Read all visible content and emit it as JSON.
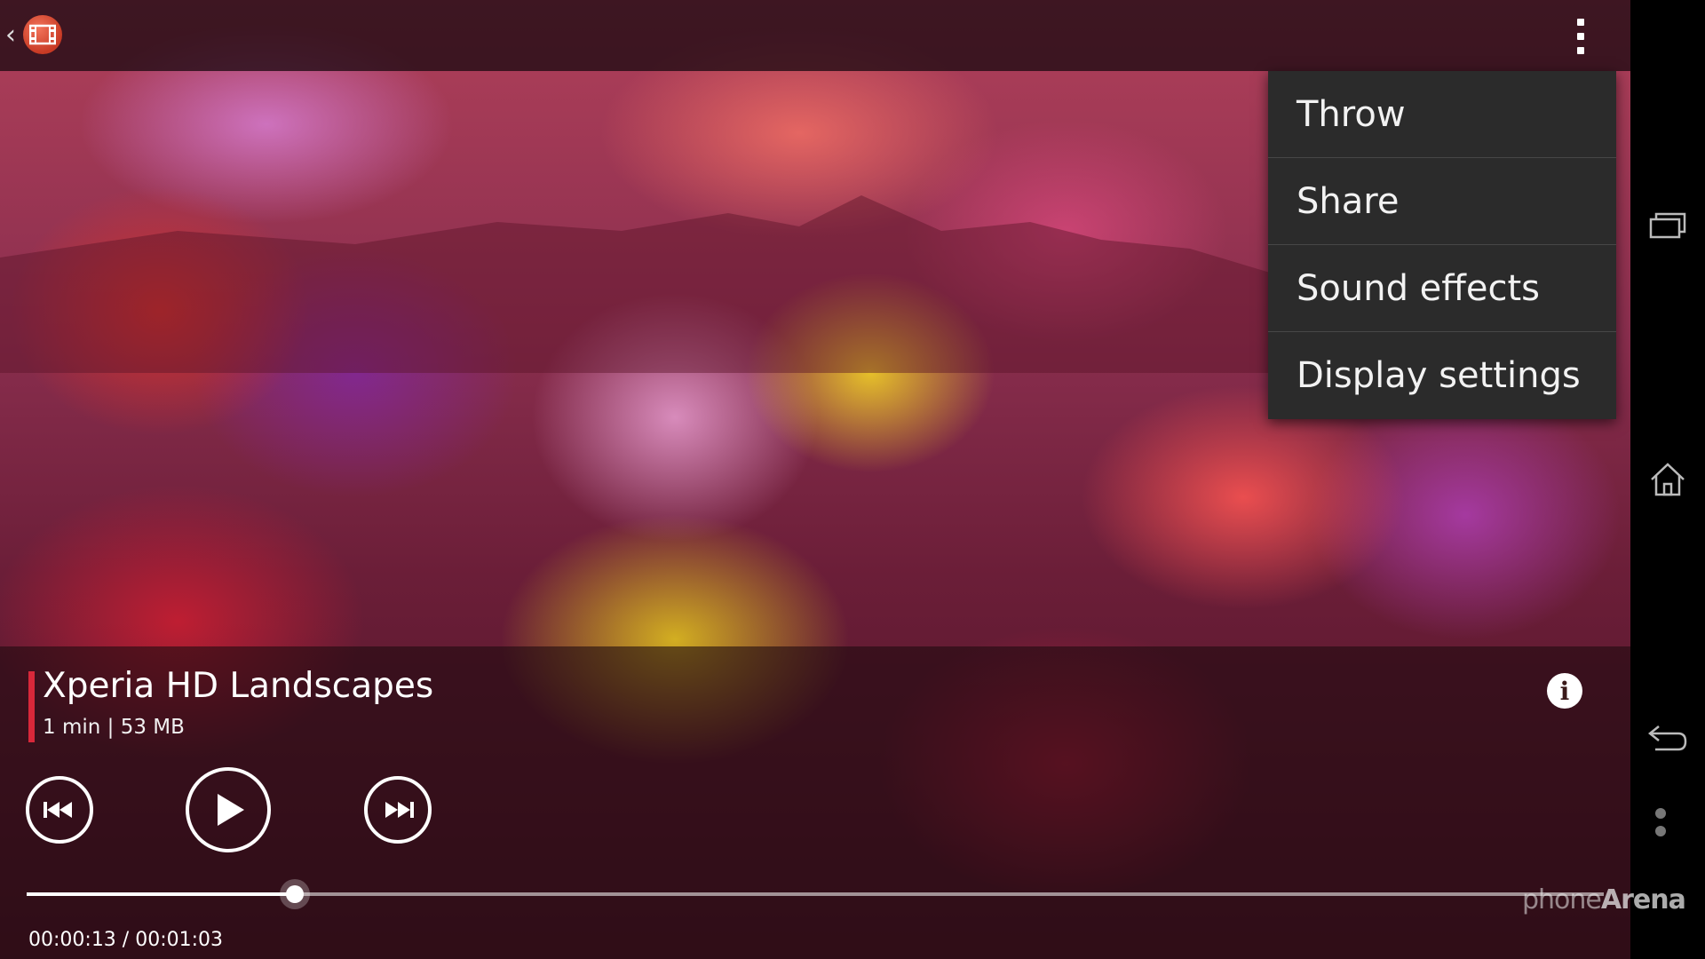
{
  "top_bar": {
    "back_icon": "chevron-left-icon",
    "app_icon": "film-strip-icon",
    "overflow_icon": "more-vertical-icon"
  },
  "menu": {
    "items": [
      {
        "label": "Throw"
      },
      {
        "label": "Share"
      },
      {
        "label": "Sound effects"
      },
      {
        "label": "Display settings"
      }
    ]
  },
  "player": {
    "title": "Xperia HD Landscapes",
    "meta": "1 min | 53 MB",
    "info_glyph": "i",
    "time_readout": "00:00:13 / 00:01:03",
    "progress_fraction": 0.17,
    "accent_color": "#d8283a"
  },
  "nav": {
    "recents_icon": "recents-icon",
    "home_icon": "home-icon",
    "back_icon": "back-arrow-icon"
  },
  "watermark": {
    "prefix": "phone",
    "brand": "Arena"
  }
}
